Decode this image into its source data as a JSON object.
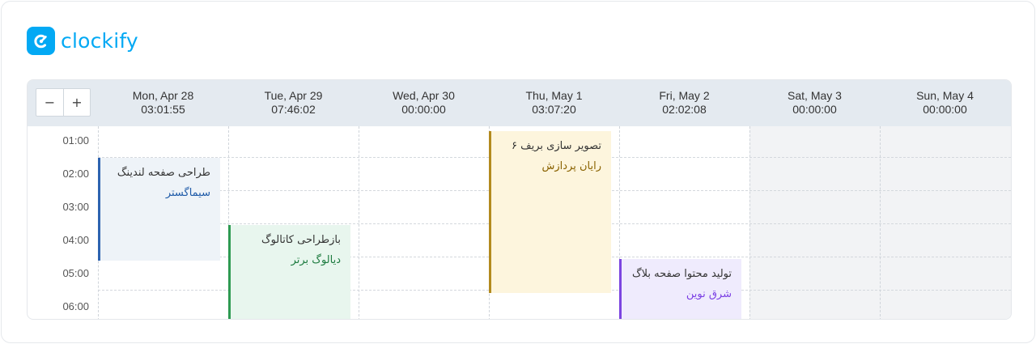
{
  "brand": {
    "name": "clockify",
    "color": "#03a9f4"
  },
  "zoom": {
    "out_label": "−",
    "in_label": "+"
  },
  "days": [
    {
      "name": "Mon, Apr 28",
      "total": "03:01:55"
    },
    {
      "name": "Tue, Apr 29",
      "total": "07:46:02"
    },
    {
      "name": "Wed, Apr 30",
      "total": "00:00:00"
    },
    {
      "name": "Thu, May 1",
      "total": "03:07:20"
    },
    {
      "name": "Fri, May 2",
      "total": "02:02:08"
    },
    {
      "name": "Sat, May 3",
      "total": "00:00:00"
    },
    {
      "name": "Sun, May 4",
      "total": "00:00:00"
    }
  ],
  "times": [
    "01:00",
    "02:00",
    "03:00",
    "04:00",
    "05:00",
    "06:00"
  ],
  "entries": [
    {
      "day": "Mon, Apr 28",
      "description": "طراحی صفحه لندینگ",
      "project": "سیماگستر",
      "project_color": "#1e5aa8",
      "bar_color": "#2d63b0",
      "bg": "#eef3f8"
    },
    {
      "day": "Tue, Apr 29",
      "description": "بازطراحی کاتالوگ",
      "project": "دیالوگ برتر",
      "project_color": "#1b7a3e",
      "bar_color": "#2e9a52",
      "bg": "#e8f6ee"
    },
    {
      "day": "Thu, May 1",
      "description": "تصویر سازی بریف ۶",
      "project": "رایان پردازش",
      "project_color": "#8a6200",
      "bar_color": "#b38a1e",
      "bg": "#fdf5dd"
    },
    {
      "day": "Fri, May 2",
      "description": "تولید محتوا صفحه بلاگ",
      "project": "شرق نوین",
      "project_color": "#7b3fe4",
      "bar_color": "#7c45e0",
      "bg": "#efebfd"
    }
  ]
}
